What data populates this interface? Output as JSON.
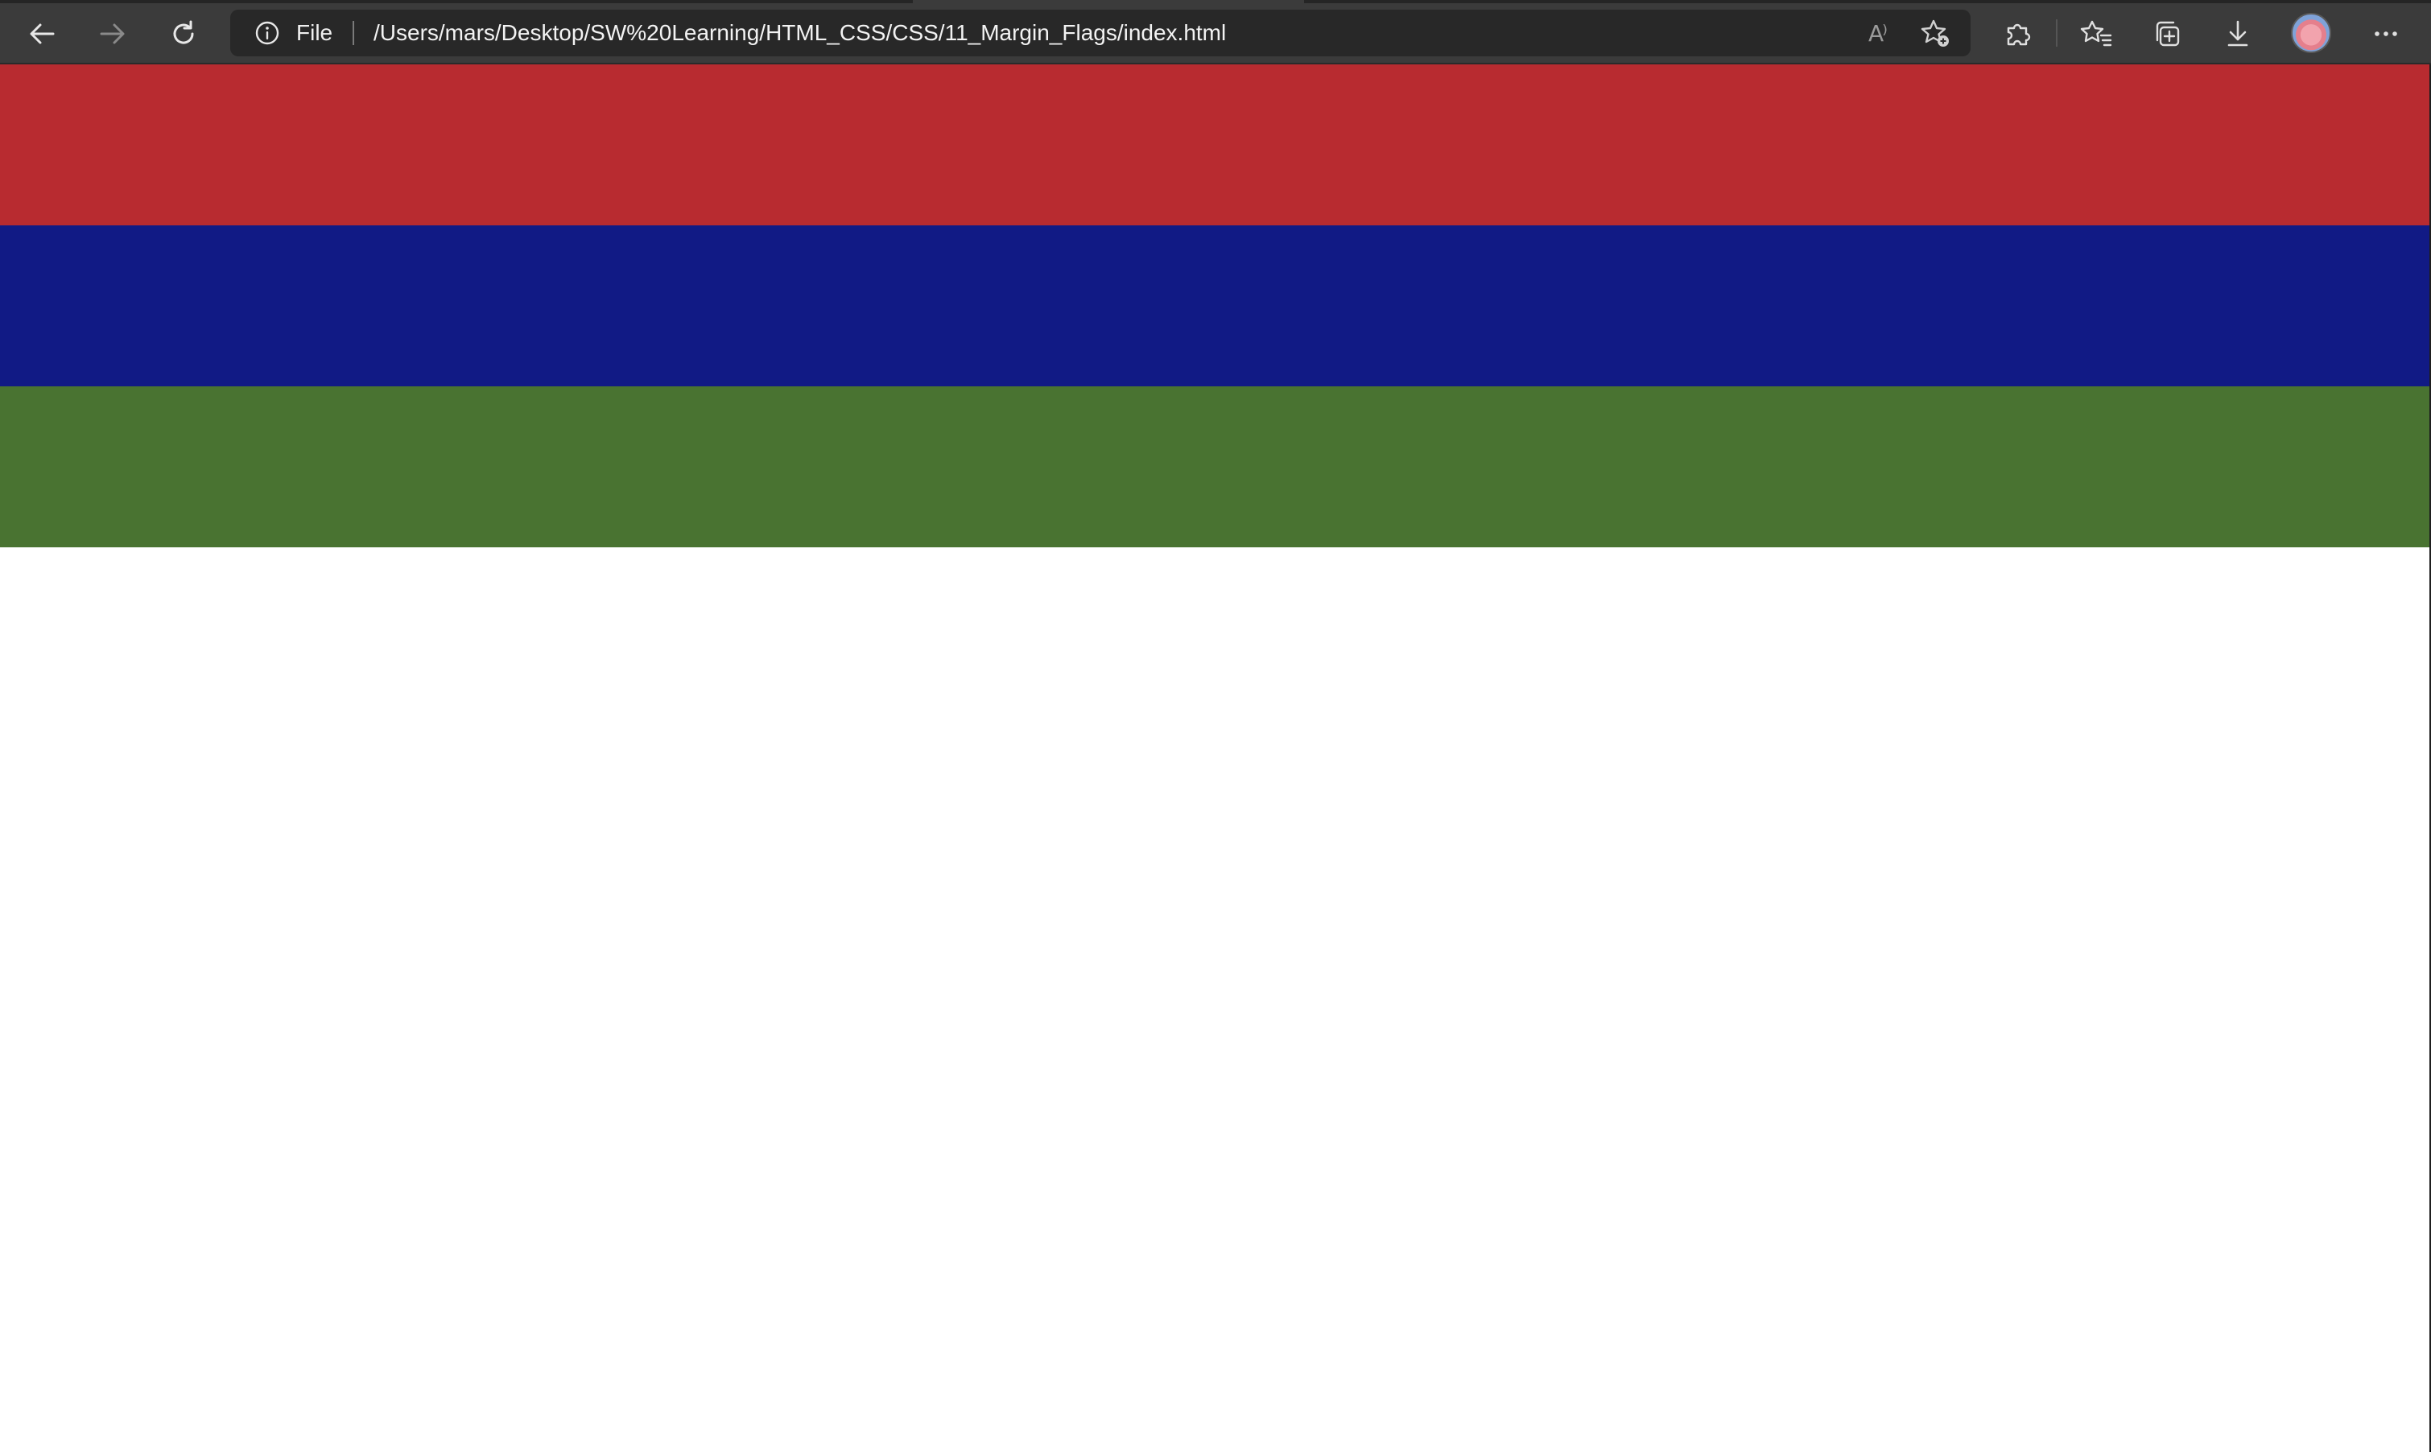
{
  "browser": {
    "address_bar": {
      "scheme_label": "File",
      "url": "/Users/mars/Desktop/SW%20Learning/HTML_CSS/CSS/11_Margin_Flags/index.html",
      "read_aloud_glyph": "A⁾"
    },
    "icons": {
      "back": "back-arrow-icon",
      "forward": "forward-arrow-icon",
      "reload": "reload-icon",
      "info": "info-icon",
      "read_aloud": "read-aloud-icon",
      "add_favorite": "star-plus-icon",
      "extensions": "puzzle-icon",
      "favorites": "favorites-icon",
      "collections": "collections-icon",
      "downloads": "download-icon",
      "profile": "avatar",
      "more": "ellipsis-icon"
    }
  },
  "flag": {
    "stripes": [
      {
        "name": "red",
        "color": "#b82b30"
      },
      {
        "name": "blue",
        "color": "#111a85"
      },
      {
        "name": "green",
        "color": "#497331"
      }
    ]
  },
  "colors": {
    "toolbar_bg": "#3b3b3b",
    "address_bg": "#282828",
    "page_bg": "#ffffff"
  }
}
